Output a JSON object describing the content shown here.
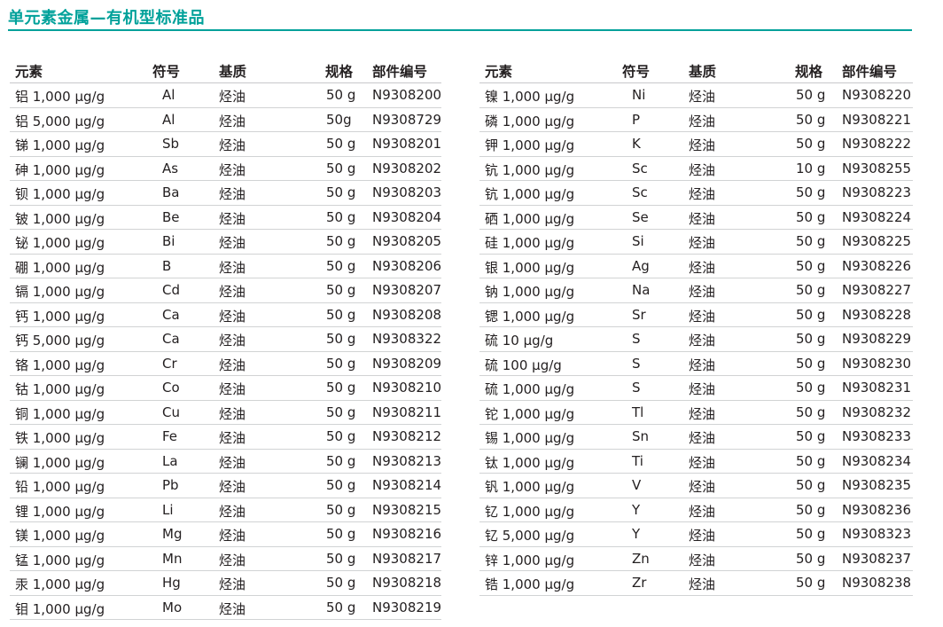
{
  "title": "单元素金属—有机型标准品",
  "headers": {
    "element": "元素",
    "symbol": "符号",
    "matrix": "基质",
    "spec": "规格",
    "part": "部件编号"
  },
  "left_rows": [
    {
      "element": "铝 1,000 µg/g",
      "symbol": "Al",
      "matrix": "烃油",
      "spec": "50 g",
      "part": "N9308200"
    },
    {
      "element": "铝 5,000 µg/g",
      "symbol": "Al",
      "matrix": "烃油",
      "spec": "50g",
      "part": "N9308729"
    },
    {
      "element": "锑 1,000 µg/g",
      "symbol": "Sb",
      "matrix": "烃油",
      "spec": "50 g",
      "part": "N9308201"
    },
    {
      "element": "砷 1,000 µg/g",
      "symbol": "As",
      "matrix": "烃油",
      "spec": "50 g",
      "part": "N9308202"
    },
    {
      "element": "钡 1,000 µg/g",
      "symbol": "Ba",
      "matrix": "烃油",
      "spec": "50 g",
      "part": "N9308203"
    },
    {
      "element": "铍 1,000 µg/g",
      "symbol": "Be",
      "matrix": "烃油",
      "spec": "50 g",
      "part": "N9308204"
    },
    {
      "element": "铋 1,000 µg/g",
      "symbol": "Bi",
      "matrix": "烃油",
      "spec": "50 g",
      "part": "N9308205"
    },
    {
      "element": "硼 1,000 µg/g",
      "symbol": "B",
      "matrix": "烃油",
      "spec": "50 g",
      "part": "N9308206"
    },
    {
      "element": "镉 1,000 µg/g",
      "symbol": "Cd",
      "matrix": "烃油",
      "spec": "50 g",
      "part": "N9308207"
    },
    {
      "element": "钙 1,000 µg/g",
      "symbol": "Ca",
      "matrix": "烃油",
      "spec": "50 g",
      "part": "N9308208"
    },
    {
      "element": "钙 5,000 µg/g",
      "symbol": "Ca",
      "matrix": "烃油",
      "spec": "50 g",
      "part": "N9308322"
    },
    {
      "element": "铬 1,000 µg/g",
      "symbol": "Cr",
      "matrix": "烃油",
      "spec": "50 g",
      "part": "N9308209"
    },
    {
      "element": "钴 1,000 µg/g",
      "symbol": "Co",
      "matrix": "烃油",
      "spec": "50 g",
      "part": "N9308210"
    },
    {
      "element": "铜 1,000 µg/g",
      "symbol": "Cu",
      "matrix": "烃油",
      "spec": "50 g",
      "part": "N9308211"
    },
    {
      "element": "铁 1,000 µg/g",
      "symbol": "Fe",
      "matrix": "烃油",
      "spec": "50 g",
      "part": "N9308212"
    },
    {
      "element": "镧 1,000 µg/g",
      "symbol": "La",
      "matrix": "烃油",
      "spec": "50 g",
      "part": "N9308213"
    },
    {
      "element": "铅 1,000 µg/g",
      "symbol": "Pb",
      "matrix": "烃油",
      "spec": "50 g",
      "part": "N9308214"
    },
    {
      "element": "锂 1,000 µg/g",
      "symbol": "Li",
      "matrix": "烃油",
      "spec": "50 g",
      "part": "N9308215"
    },
    {
      "element": "镁 1,000 µg/g",
      "symbol": "Mg",
      "matrix": "烃油",
      "spec": "50 g",
      "part": "N9308216"
    },
    {
      "element": "锰 1,000 µg/g",
      "symbol": "Mn",
      "matrix": "烃油",
      "spec": "50 g",
      "part": "N9308217"
    },
    {
      "element": "汞 1,000 µg/g",
      "symbol": "Hg",
      "matrix": "烃油",
      "spec": "50 g",
      "part": "N9308218"
    },
    {
      "element": "钼 1,000 µg/g",
      "symbol": "Mo",
      "matrix": "烃油",
      "spec": "50 g",
      "part": "N9308219"
    }
  ],
  "right_rows": [
    {
      "element": "镍 1,000 µg/g",
      "symbol": "Ni",
      "matrix": "烃油",
      "spec": "50 g",
      "part": "N9308220"
    },
    {
      "element": "磷 1,000 µg/g",
      "symbol": "P",
      "matrix": "烃油",
      "spec": "50 g",
      "part": "N9308221"
    },
    {
      "element": "钾 1,000 µg/g",
      "symbol": "K",
      "matrix": "烃油",
      "spec": "50 g",
      "part": "N9308222"
    },
    {
      "element": "钪 1,000 µg/g",
      "symbol": "Sc",
      "matrix": "烃油",
      "spec": "10 g",
      "part": "N9308255"
    },
    {
      "element": "钪 1,000 µg/g",
      "symbol": "Sc",
      "matrix": "烃油",
      "spec": "50 g",
      "part": "N9308223"
    },
    {
      "element": "硒 1,000 µg/g",
      "symbol": "Se",
      "matrix": "烃油",
      "spec": "50 g",
      "part": "N9308224"
    },
    {
      "element": "硅 1,000 µg/g",
      "symbol": "Si",
      "matrix": "烃油",
      "spec": "50 g",
      "part": "N9308225"
    },
    {
      "element": "银 1,000 µg/g",
      "symbol": "Ag",
      "matrix": "烃油",
      "spec": "50 g",
      "part": "N9308226"
    },
    {
      "element": "钠 1,000 µg/g",
      "symbol": "Na",
      "matrix": "烃油",
      "spec": "50 g",
      "part": "N9308227"
    },
    {
      "element": "锶 1,000 µg/g",
      "symbol": "Sr",
      "matrix": "烃油",
      "spec": "50 g",
      "part": "N9308228"
    },
    {
      "element": "硫 10 µg/g",
      "symbol": "S",
      "matrix": "烃油",
      "spec": "50 g",
      "part": "N9308229"
    },
    {
      "element": "硫 100 µg/g",
      "symbol": "S",
      "matrix": "烃油",
      "spec": "50 g",
      "part": "N9308230"
    },
    {
      "element": "硫 1,000 µg/g",
      "symbol": "S",
      "matrix": "烃油",
      "spec": "50 g",
      "part": "N9308231"
    },
    {
      "element": "铊 1,000 µg/g",
      "symbol": "Tl",
      "matrix": "烃油",
      "spec": "50 g",
      "part": "N9308232"
    },
    {
      "element": "锡 1,000 µg/g",
      "symbol": "Sn",
      "matrix": "烃油",
      "spec": "50 g",
      "part": "N9308233"
    },
    {
      "element": "钛 1,000 µg/g",
      "symbol": "Ti",
      "matrix": "烃油",
      "spec": "50 g",
      "part": "N9308234"
    },
    {
      "element": "钒 1,000 µg/g",
      "symbol": "V",
      "matrix": "烃油",
      "spec": "50 g",
      "part": "N9308235"
    },
    {
      "element": "钇 1,000 µg/g",
      "symbol": "Y",
      "matrix": "烃油",
      "spec": "50 g",
      "part": "N9308236"
    },
    {
      "element": "钇 5,000 µg/g",
      "symbol": "Y",
      "matrix": "烃油",
      "spec": "50 g",
      "part": "N9308323"
    },
    {
      "element": "锌 1,000 µg/g",
      "symbol": "Zn",
      "matrix": "烃油",
      "spec": "50 g",
      "part": "N9308237"
    },
    {
      "element": "锆 1,000 µg/g",
      "symbol": "Zr",
      "matrix": "烃油",
      "spec": "50 g",
      "part": "N9308238"
    }
  ]
}
